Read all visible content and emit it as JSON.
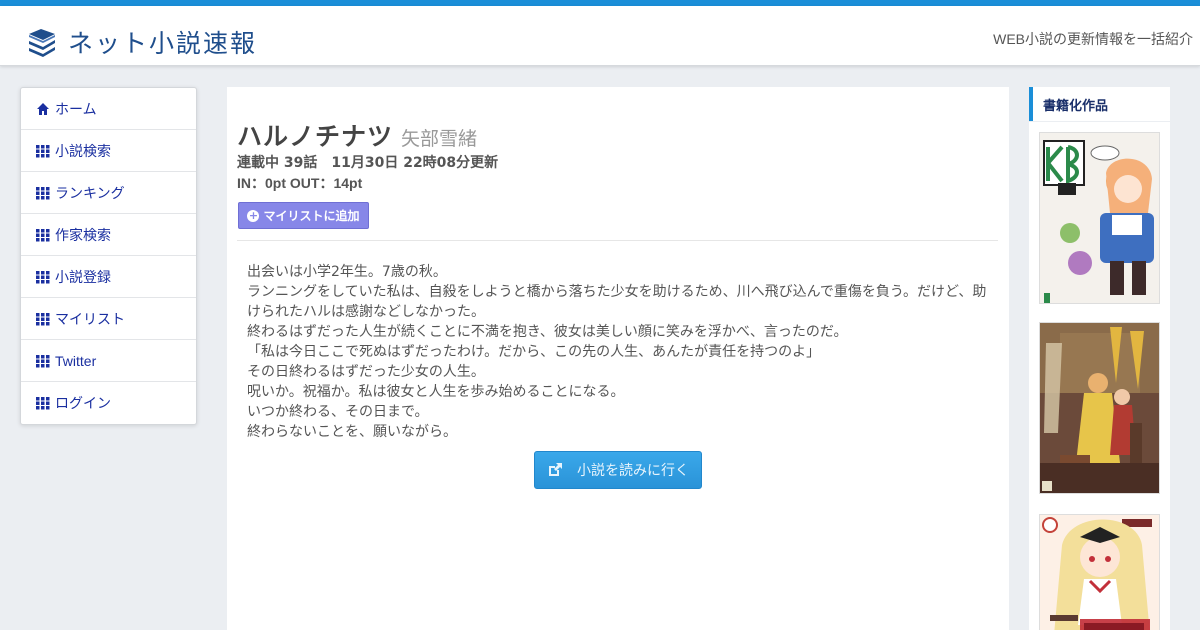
{
  "header": {
    "site_title": "ネット小説速報",
    "tagline": "WEB小説の更新情報を一括紹介"
  },
  "sidenav": {
    "items": [
      {
        "label": "ホーム",
        "icon": "home-icon"
      },
      {
        "label": "小説検索",
        "icon": "grid-icon"
      },
      {
        "label": "ランキング",
        "icon": "grid-icon"
      },
      {
        "label": "作家検索",
        "icon": "grid-icon"
      },
      {
        "label": "小説登録",
        "icon": "grid-icon"
      },
      {
        "label": "マイリスト",
        "icon": "grid-icon"
      },
      {
        "label": "Twitter",
        "icon": "grid-icon"
      },
      {
        "label": "ログイン",
        "icon": "grid-icon"
      }
    ]
  },
  "novel": {
    "title": "ハルノチナツ",
    "author": "矢部雪緒",
    "status": "連載中 39話",
    "updated": "11月30日 22時08分更新",
    "points": "IN：0pt OUT：14pt",
    "mylist_label": "マイリストに追加",
    "synopsis": [
      "出会いは小学2年生。7歳の秋。",
      "ランニングをしていた私は、自殺をしようと橋から落ちた少女を助けるため、川へ飛び込んで重傷を負う。だけど、助",
      "けられたハルは感謝などしなかった。",
      "終わるはずだった人生が続くことに不満を抱き、彼女は美しい顔に笑みを浮かべ、言ったのだ。",
      "「私は今日ここで死ぬはずだったわけ。だから、この先の人生、あんたが責任を持つのよ」",
      "その日終わるはずだった少女の人生。",
      "呪いか。祝福か。私は彼女と人生を歩み始めることになる。",
      "いつか終わる、その日まで。",
      "終わらないことを、願いながら。"
    ],
    "read_label": "小説を読みに行く"
  },
  "sidebar_right": {
    "heading": "書籍化作品"
  },
  "colors": {
    "accent": "#1a8ed8",
    "nav_link": "#1a2fa0",
    "mylist_button": "#8787e8",
    "read_button": "#2a93d8"
  }
}
